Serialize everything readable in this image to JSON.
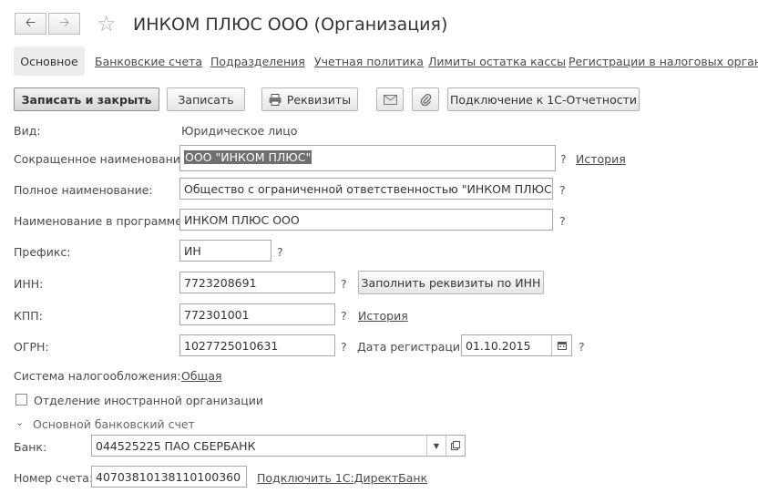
{
  "header": {
    "title": "ИНКОМ ПЛЮС ООО (Организация)"
  },
  "tabs": [
    {
      "label": "Основное"
    },
    {
      "label": "Банковские счета"
    },
    {
      "label": "Подразделения"
    },
    {
      "label": "Учетная политика"
    },
    {
      "label": "Лимиты остатка кассы"
    },
    {
      "label": "Регистрации в налоговых органах"
    }
  ],
  "toolbar": {
    "save_close": "Записать и закрыть",
    "save": "Записать",
    "requisites": "Реквизиты",
    "connect_reporting": "Подключение к 1С-Отчетности"
  },
  "form": {
    "kind_label": "Вид:",
    "kind_value": "Юридическое лицо",
    "short_name_label": "Сокращенное наименование:",
    "short_name_value": "ООО \"ИНКОМ ПЛЮС\"",
    "full_name_label": "Полное наименование:",
    "full_name_value": "Общество с ограниченной ответственностью \"ИНКОМ ПЛЮС\"",
    "program_name_label": "Наименование в программе:",
    "program_name_value": "ИНКОМ ПЛЮС ООО",
    "prefix_label": "Префикс:",
    "prefix_value": "ИН",
    "inn_label": "ИНН:",
    "inn_value": "7723208691",
    "fill_by_inn": "Заполнить реквизиты по ИНН",
    "kpp_label": "КПП:",
    "kpp_value": "772301001",
    "ogrn_label": "ОГРН:",
    "ogrn_value": "1027725010631",
    "reg_date_label": "Дата регистрации:",
    "reg_date_value": "01.10.2015",
    "tax_system_label": "Система налогообложения:",
    "tax_system_value": "Общая",
    "foreign_branch_label": "Отделение иностранной организации",
    "history_link": "История",
    "question": "?"
  },
  "bank_section": {
    "title": "Основной банковский счет",
    "bank_label": "Банк:",
    "bank_value": "044525225 ПАО СБЕРБАНК",
    "account_label": "Номер счета:",
    "account_value": "40703810138110100360",
    "direct_bank_link": "Подключить 1С:ДиректБанк"
  }
}
